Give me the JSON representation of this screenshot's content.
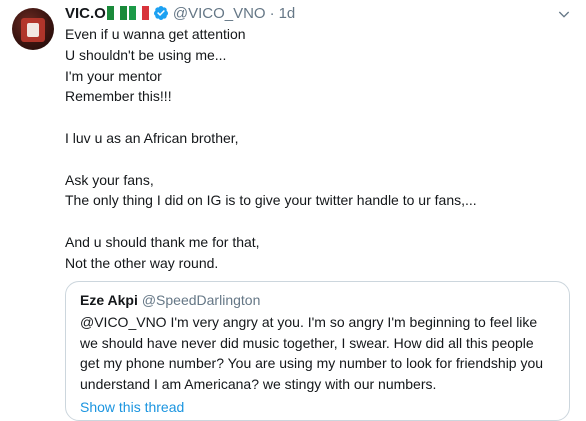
{
  "tweet": {
    "author_name": "VIC.O",
    "author_handle": "@VICO_VNO",
    "separator": "·",
    "time": "1d",
    "lines": [
      "Even if u wanna get attention",
      "U shouldn't be using me...",
      "I'm your mentor",
      "Remember this!!!",
      "",
      "I luv u as an African brother,",
      "",
      "Ask your fans,",
      "The only thing I did on IG is to give your twitter handle to ur fans,...",
      "",
      "And u should thank me for that,",
      "Not the other way round."
    ]
  },
  "quote": {
    "author_name": "Eze Akpi",
    "author_handle": "@SpeedDarlington",
    "text": "@VICO_VNO I'm very angry at you. I'm so angry I'm beginning to feel like we should have never did music together, I swear. How did all this people get my phone number? You are using my number to look for friendship you understand I am Americana? we stingy with our numbers.",
    "show_thread": "Show this thread"
  },
  "colors": {
    "text": "#14171a",
    "secondary": "#657786",
    "link": "#1b95e0",
    "border": "#ccd6dd",
    "verified": "#1da1f2"
  },
  "icons": [
    "avatar",
    "nigeria-flag-icon",
    "italy-flag-icon",
    "verified-icon",
    "chevron-down-icon"
  ]
}
